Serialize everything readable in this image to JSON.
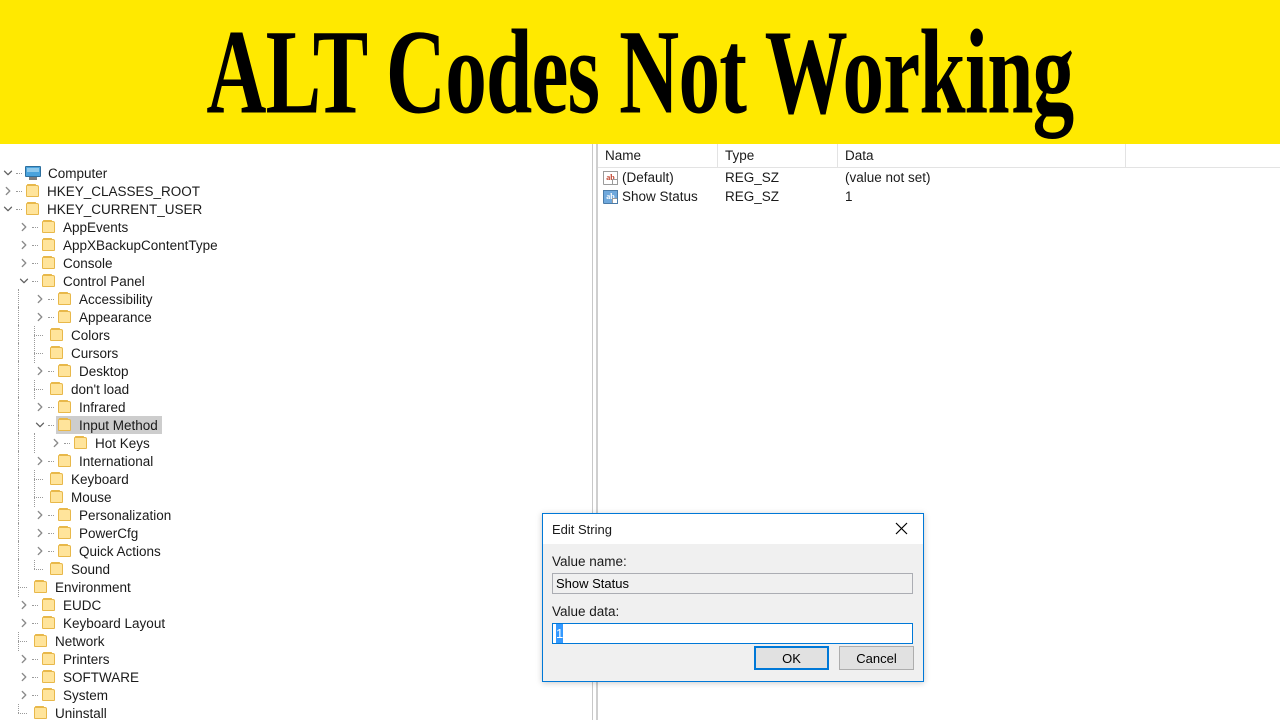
{
  "banner": {
    "title": "ALT Codes Not Working",
    "background_color": "#ffe900",
    "text_color": "#000000"
  },
  "tree": {
    "nodes": [
      {
        "label": "Computer",
        "depth": 0,
        "icon": "monitor-icon",
        "state": "expanded",
        "selected": false
      },
      {
        "label": "HKEY_CLASSES_ROOT",
        "depth": 1,
        "icon": "folder-icon",
        "state": "collapsed",
        "selected": false
      },
      {
        "label": "HKEY_CURRENT_USER",
        "depth": 1,
        "icon": "folder-icon",
        "state": "expanded",
        "selected": false
      },
      {
        "label": "AppEvents",
        "depth": 2,
        "icon": "folder-icon",
        "state": "collapsed",
        "selected": false
      },
      {
        "label": "AppXBackupContentType",
        "depth": 2,
        "icon": "folder-icon",
        "state": "collapsed",
        "selected": false
      },
      {
        "label": "Console",
        "depth": 2,
        "icon": "folder-icon",
        "state": "collapsed",
        "selected": false
      },
      {
        "label": "Control Panel",
        "depth": 2,
        "icon": "folder-icon",
        "state": "expanded",
        "selected": false
      },
      {
        "label": "Accessibility",
        "depth": 3,
        "icon": "folder-icon",
        "state": "collapsed",
        "selected": false
      },
      {
        "label": "Appearance",
        "depth": 3,
        "icon": "folder-icon",
        "state": "collapsed",
        "selected": false
      },
      {
        "label": "Colors",
        "depth": 3,
        "icon": "folder-icon",
        "state": "leaf",
        "selected": false
      },
      {
        "label": "Cursors",
        "depth": 3,
        "icon": "folder-icon",
        "state": "leaf",
        "selected": false
      },
      {
        "label": "Desktop",
        "depth": 3,
        "icon": "folder-icon",
        "state": "collapsed",
        "selected": false
      },
      {
        "label": "don't load",
        "depth": 3,
        "icon": "folder-icon",
        "state": "leaf",
        "selected": false
      },
      {
        "label": "Infrared",
        "depth": 3,
        "icon": "folder-icon",
        "state": "collapsed",
        "selected": false
      },
      {
        "label": "Input Method",
        "depth": 3,
        "icon": "folder-icon",
        "state": "expanded",
        "selected": true
      },
      {
        "label": "Hot Keys",
        "depth": 4,
        "icon": "folder-icon",
        "state": "collapsed",
        "selected": false
      },
      {
        "label": "International",
        "depth": 3,
        "icon": "folder-icon",
        "state": "collapsed",
        "selected": false
      },
      {
        "label": "Keyboard",
        "depth": 3,
        "icon": "folder-icon",
        "state": "leaf",
        "selected": false
      },
      {
        "label": "Mouse",
        "depth": 3,
        "icon": "folder-icon",
        "state": "leaf",
        "selected": false
      },
      {
        "label": "Personalization",
        "depth": 3,
        "icon": "folder-icon",
        "state": "collapsed",
        "selected": false
      },
      {
        "label": "PowerCfg",
        "depth": 3,
        "icon": "folder-icon",
        "state": "collapsed",
        "selected": false
      },
      {
        "label": "Quick Actions",
        "depth": 3,
        "icon": "folder-icon",
        "state": "collapsed",
        "selected": false
      },
      {
        "label": "Sound",
        "depth": 3,
        "icon": "folder-icon",
        "state": "leaf",
        "selected": false
      },
      {
        "label": "Environment",
        "depth": 2,
        "icon": "folder-icon",
        "state": "leaf",
        "selected": false
      },
      {
        "label": "EUDC",
        "depth": 2,
        "icon": "folder-icon",
        "state": "collapsed",
        "selected": false
      },
      {
        "label": "Keyboard Layout",
        "depth": 2,
        "icon": "folder-icon",
        "state": "collapsed",
        "selected": false
      },
      {
        "label": "Network",
        "depth": 2,
        "icon": "folder-icon",
        "state": "leaf",
        "selected": false
      },
      {
        "label": "Printers",
        "depth": 2,
        "icon": "folder-icon",
        "state": "collapsed",
        "selected": false
      },
      {
        "label": "SOFTWARE",
        "depth": 2,
        "icon": "folder-icon",
        "state": "collapsed",
        "selected": false
      },
      {
        "label": "System",
        "depth": 2,
        "icon": "folder-icon",
        "state": "collapsed",
        "selected": false
      },
      {
        "label": "Uninstall",
        "depth": 2,
        "icon": "folder-icon",
        "state": "leaf",
        "selected": false
      }
    ]
  },
  "values_list": {
    "columns": [
      "Name",
      "Type",
      "Data"
    ],
    "rows": [
      {
        "icon": "string-value-icon-red",
        "name": "(Default)",
        "type": "REG_SZ",
        "data": "(value not set)"
      },
      {
        "icon": "string-value-icon-blue",
        "name": "Show Status",
        "type": "REG_SZ",
        "data": "1"
      }
    ]
  },
  "dialog": {
    "title": "Edit String",
    "close_label": "×",
    "value_name_label": "Value name:",
    "value_name": "Show Status",
    "value_data_label": "Value data:",
    "value_data": "1",
    "ok_label": "OK",
    "cancel_label": "Cancel",
    "accent_color": "#0078d7",
    "selection_color": "#3399ff"
  }
}
